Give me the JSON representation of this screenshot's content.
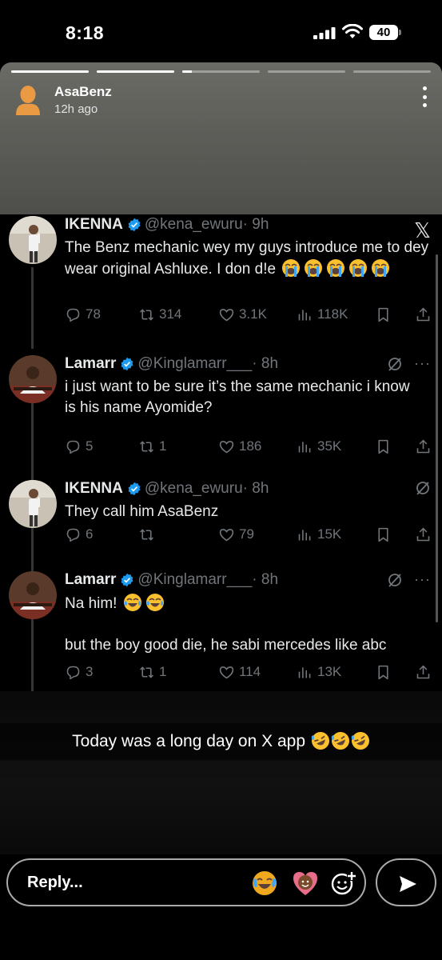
{
  "status_bar": {
    "time": "8:18",
    "battery": "40"
  },
  "story": {
    "user_name": "AsaBenz",
    "posted_ago": "12h ago",
    "progress": [
      1,
      1,
      0.12,
      0,
      0
    ],
    "caption": "Today was a long day on X app"
  },
  "tweets": [
    {
      "name": "IKENNA",
      "verified": true,
      "handle": "@kena_ewuru",
      "time": "· 9h",
      "text": "The Benz mechanic wey my guys introduce me to dey wear original Ashluxe. I don d!e",
      "replies": "78",
      "reposts": "314",
      "likes": "3.1K",
      "views": "118K"
    },
    {
      "name": "Lamarr",
      "verified": true,
      "handle": "@Kinglamarr___",
      "time": "· 8h",
      "text_lines": [
        "i just want to be sure it’s the same mechanic i know",
        "is his name Ayomide?"
      ],
      "replies": "5",
      "reposts": "1",
      "likes": "186",
      "views": "35K"
    },
    {
      "name": "IKENNA",
      "verified": true,
      "handle": "@kena_ewuru",
      "time": "· 8h",
      "text": "They call him AsaBenz",
      "replies": "6",
      "reposts": "",
      "likes": "79",
      "views": "15K"
    },
    {
      "name": "Lamarr",
      "verified": true,
      "handle": "@Kinglamarr___",
      "time": "· 8h",
      "text_line1": "Na him!",
      "text_line2": "but the boy good die, he sabi mercedes like abc",
      "replies": "3",
      "reposts": "1",
      "likes": "114",
      "views": "13K"
    }
  ],
  "reply": {
    "placeholder": "Reply..."
  },
  "icons": {
    "menu": "kebab-icon",
    "brand": "x-logo-icon",
    "verified": "verified-badge-icon",
    "reply": "reply-icon",
    "repost": "repost-icon",
    "like": "like-icon",
    "views": "views-icon",
    "bookmark": "bookmark-icon",
    "share": "share-icon",
    "grok": "grok-icon",
    "send": "send-icon",
    "quick_reactions": [
      "crying-laughing-emoji",
      "heart-face-emoji",
      "add-reaction-icon"
    ]
  },
  "colors": {
    "verified": "#1d9bf0",
    "muted": "#71767b",
    "text": "#e7e9ea",
    "background": "#000000"
  }
}
